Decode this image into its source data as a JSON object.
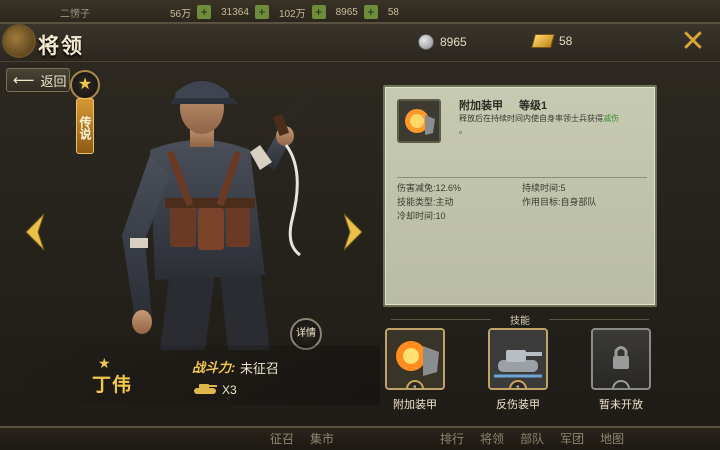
{
  "hud": {
    "player_name": "二愣子",
    "resources": [
      "56万",
      "31364",
      "102万",
      "8965",
      "58"
    ],
    "bottom_tabs": [
      "征召",
      "集市",
      "排行",
      "将领",
      "部队",
      "军团",
      "地图"
    ]
  },
  "header": {
    "title": "将领",
    "silver": "8965",
    "gold": "58"
  },
  "back_label": "返回",
  "rank_label": "传说",
  "detail_label": "详情",
  "general": {
    "name": "丁伟",
    "power_label": "战斗力:",
    "power_value": "未征召",
    "troops": "X3"
  },
  "skill_card": {
    "name": "附加装甲",
    "level": "等级1",
    "desc_prefix": "释放后在持续时间内使自身率领士兵获得",
    "desc_highlight": "减伤",
    "desc_suffix": "。",
    "stats": {
      "reduction": "伤害减免:12.6%",
      "duration": "持续时间:5",
      "type": "技能类型:主动",
      "target": "作用目标:自身部队",
      "cooldown": "冷却时间:10"
    }
  },
  "skills_header": "技能",
  "skills": [
    {
      "label": "附加装甲",
      "level": "1",
      "locked": false
    },
    {
      "label": "反伤装甲",
      "level": "1",
      "locked": false
    },
    {
      "label": "暂未开放",
      "level": "",
      "locked": true
    }
  ],
  "colors": {
    "accent_gold": "#f3c84a",
    "highlight_green": "#3d8a2a",
    "close_orange": "#d9a53a"
  }
}
